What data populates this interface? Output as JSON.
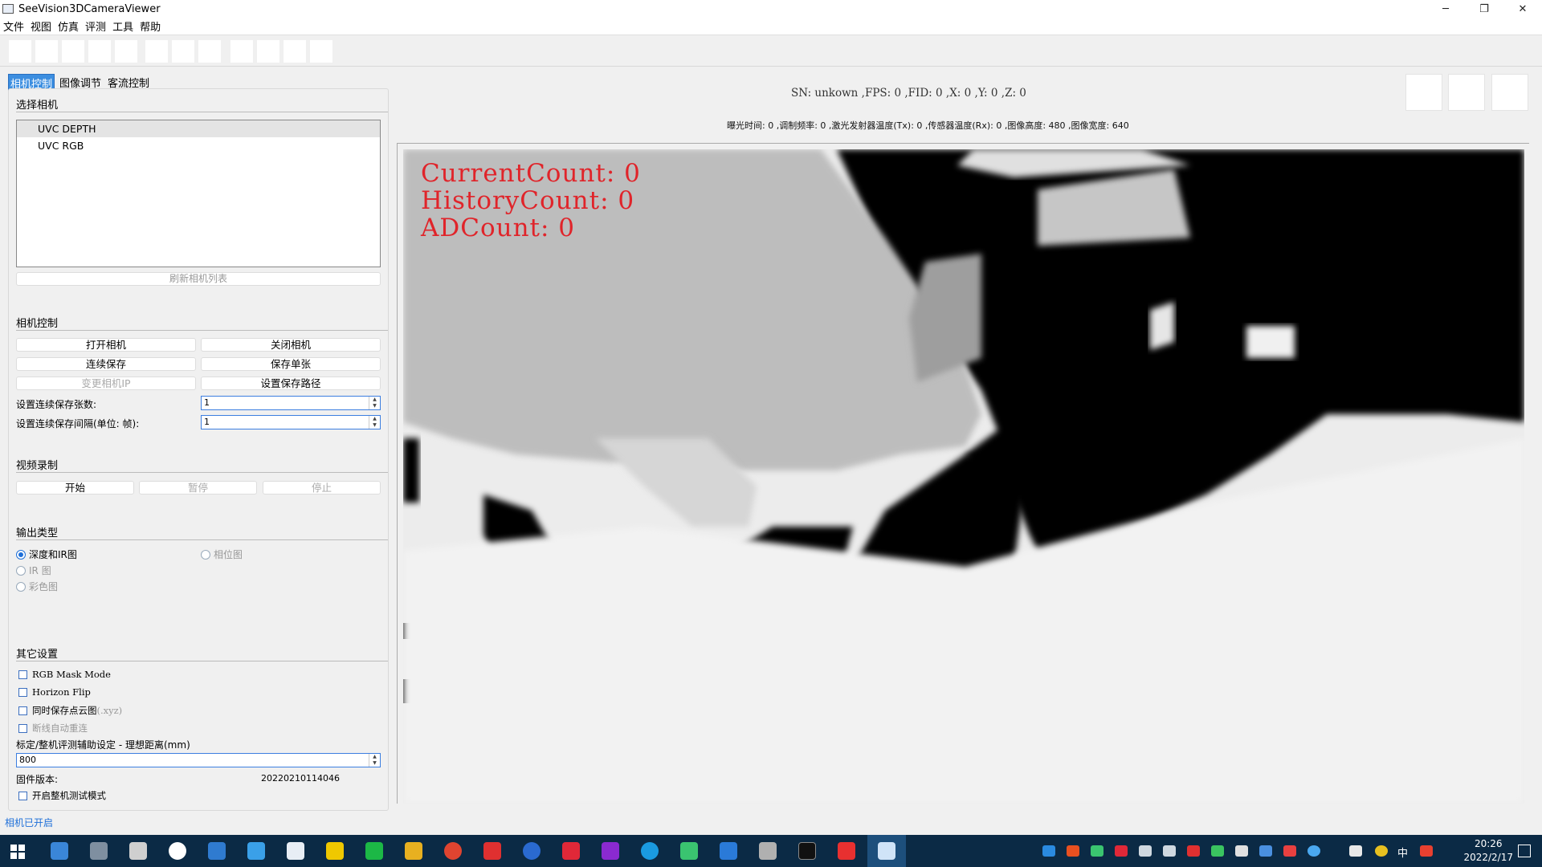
{
  "window": {
    "title": "SeeVision3DCameraViewer",
    "controls": {
      "minimize": "─",
      "restore": "❐",
      "close": "✕"
    }
  },
  "menu": [
    "文件",
    "视图",
    "仿真",
    "评测",
    "工具",
    "帮助"
  ],
  "tabs": [
    {
      "label": "相机控制",
      "active": true
    },
    {
      "label": "图像调节",
      "active": false
    },
    {
      "label": "客流控制",
      "active": false
    }
  ],
  "select_camera": {
    "title": "选择相机",
    "cameras": [
      {
        "label": "UVC DEPTH",
        "selected": true
      },
      {
        "label": "UVC RGB",
        "selected": false
      }
    ],
    "refresh_label": "刷新相机列表"
  },
  "camera_control": {
    "title": "相机控制",
    "open": "打开相机",
    "close": "关闭相机",
    "continuous_save": "连续保存",
    "save_single": "保存单张",
    "change_ip": "变更相机IP",
    "set_save_path": "设置保存路径",
    "count_label": "设置连续保存张数:",
    "count_value": "1",
    "interval_label": "设置连续保存间隔(单位: 帧):",
    "interval_value": "1"
  },
  "video_record": {
    "title": "视频录制",
    "start": "开始",
    "pause": "暂停",
    "stop": "停止"
  },
  "output_type": {
    "title": "输出类型",
    "options": [
      {
        "label": "深度和IR图",
        "checked": true,
        "enabled": true
      },
      {
        "label": "相位图",
        "checked": false,
        "enabled": false
      },
      {
        "label": "IR 图",
        "checked": false,
        "enabled": false
      },
      {
        "label": "彩色图",
        "checked": false,
        "enabled": false
      }
    ]
  },
  "other_settings": {
    "title": "其它设置",
    "rgb_mask": "RGB Mask Mode",
    "horizon_flip": "Horizon Flip",
    "save_pointcloud": "同时保存点云图",
    "save_pointcloud_suffix": "(.xyz)",
    "auto_reconnect": "断线自动重连",
    "calib_label": "标定/整机评测辅助设定 - 理想距离(mm)",
    "calib_value": "800",
    "firmware_label": "固件版本:",
    "firmware_value": "20220210114046",
    "test_mode": "开启整机测试模式"
  },
  "status": "相机已开启",
  "info": {
    "line1": "SN: unkown ,FPS: 0 ,FID: 0 ,X: 0  ,Y: 0  ,Z: 0",
    "line2": "曝光时间: 0 ,调制频率: 0 ,激光发射器温度(Tx): 0 ,传感器温度(Rx): 0 ,图像高度: 480 ,图像宽度: 640"
  },
  "overlay": {
    "current": "CurrentCount: 0",
    "history": "HistoryCount: 0",
    "ad": "ADCount: 0"
  },
  "taskbar": {
    "time": "20:26",
    "date": "2022/2/17",
    "ime": "中"
  },
  "colors": {
    "accent": "#3c8ee0",
    "overlay_text": "#e0242a",
    "taskbar": "#0b2a45",
    "status_text": "#1e6fd8"
  }
}
